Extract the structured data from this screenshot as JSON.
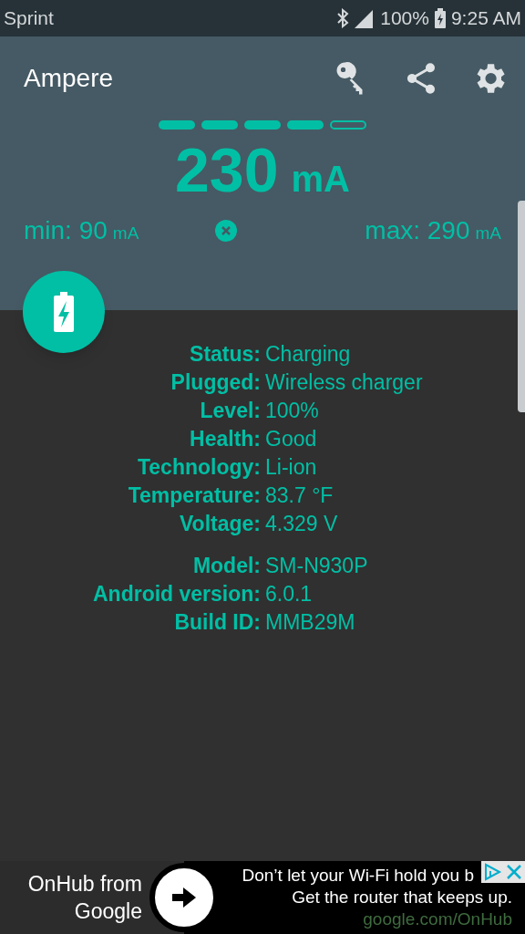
{
  "status_bar": {
    "carrier": "Sprint",
    "battery": "100%",
    "time": "9:25 AM"
  },
  "app_bar": {
    "title": "Ampere"
  },
  "meter": {
    "segments": [
      {
        "filled": true
      },
      {
        "filled": true
      },
      {
        "filled": true
      },
      {
        "filled": true
      },
      {
        "filled": false
      }
    ],
    "value": "230",
    "unit": "mA",
    "min_label": "min: 90",
    "min_unit": "mA",
    "max_label": "max: 290",
    "max_unit": "mA"
  },
  "info_groups": [
    [
      {
        "label": "Status:",
        "value": "Charging"
      },
      {
        "label": "Plugged:",
        "value": "Wireless charger"
      },
      {
        "label": "Level:",
        "value": "100%"
      },
      {
        "label": "Health:",
        "value": "Good"
      },
      {
        "label": "Technology:",
        "value": "Li-ion"
      },
      {
        "label": "Temperature:",
        "value": "83.7 °F"
      },
      {
        "label": "Voltage:",
        "value": "4.329 V"
      }
    ],
    [
      {
        "label": "Model:",
        "value": "SM-N930P"
      },
      {
        "label": "Android version:",
        "value": "6.0.1"
      },
      {
        "label": "Build ID:",
        "value": "MMB29M"
      }
    ]
  ],
  "ad": {
    "left_line_1": "OnHub from",
    "left_line_2": "Google",
    "line_1": "Don’t let your Wi‑Fi hold you b",
    "line_2": "Get the router that keeps up.",
    "url": "google.com/OnHub"
  }
}
